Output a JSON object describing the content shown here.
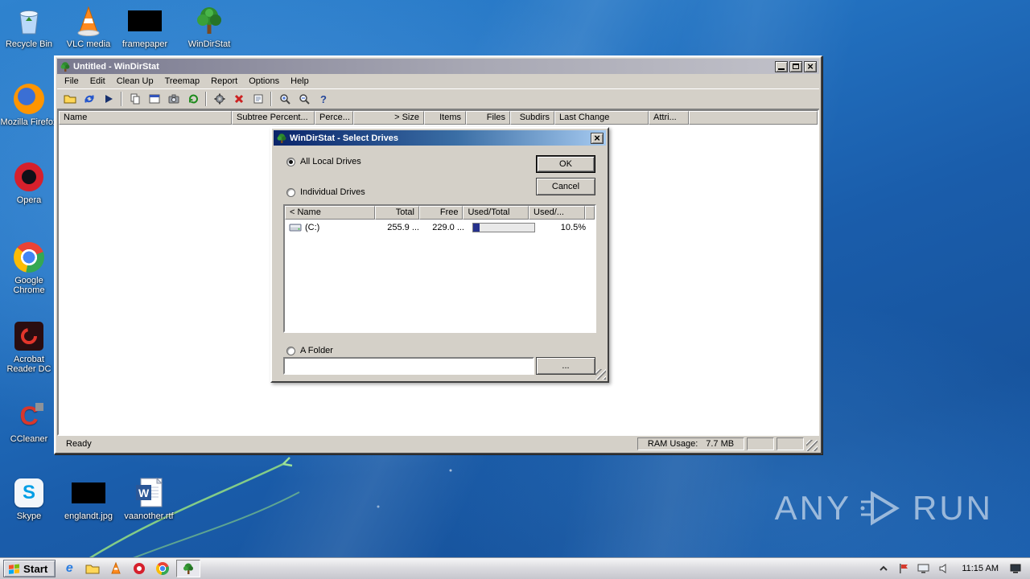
{
  "app": {
    "name": "WinDirStat"
  },
  "desktop": {
    "icons": {
      "recycle_bin": "Recycle Bin",
      "vlc": "VLC media",
      "framepaper": "framepaper",
      "windirstat": "WinDirStat",
      "firefox": "Mozilla Firefox",
      "opera": "Opera",
      "chrome": "Google Chrome",
      "acrobat": "Acrobat Reader DC",
      "ccleaner": "CCleaner",
      "skype": "Skype",
      "englandt": "englandt.jpg",
      "vaanother": "vaanother.rtf"
    },
    "watermark": {
      "left": "ANY",
      "right": "RUN"
    }
  },
  "main_window": {
    "title": "Untitled - WinDirStat",
    "menu": [
      "File",
      "Edit",
      "Clean Up",
      "Treemap",
      "Report",
      "Options",
      "Help"
    ],
    "toolbar_icons": [
      "open",
      "refresh-all",
      "resume",
      "copy",
      "open-explorer",
      "screenshot",
      "refresh-selected",
      "configure",
      "delete",
      "properties",
      "zoom-in",
      "zoom-out",
      "help"
    ],
    "columns": [
      "Name",
      "Subtree Percent...",
      "Perce...",
      "> Size",
      "Items",
      "Files",
      "Subdirs",
      "Last Change",
      "Attri..."
    ],
    "status": {
      "ready": "Ready",
      "ram_label": "RAM Usage:",
      "ram_value": "7.7 MB"
    }
  },
  "dialog": {
    "title": "WinDirStat - Select Drives",
    "options": {
      "all": "All Local Drives",
      "individual": "Individual Drives",
      "folder": "A Folder"
    },
    "selected_option": "All Local Drives",
    "buttons": {
      "ok": "OK",
      "cancel": "Cancel",
      "browse": "..."
    },
    "drive_list": {
      "columns": [
        "< Name",
        "Total",
        "Free",
        "Used/Total",
        "Used/..."
      ],
      "rows": [
        {
          "name": "(C:)",
          "total": "255.9 ...",
          "free": "229.0 ...",
          "used_pct": "10.5%",
          "used_fraction": 0.105
        }
      ]
    },
    "folder_path": ""
  },
  "taskbar": {
    "start": "Start",
    "quick_launch": [
      "internet-explorer",
      "explorer-folder",
      "vlc",
      "opera",
      "chrome"
    ],
    "active_task": "windirstat",
    "tray_icons": [
      "hidden-icons-chevron",
      "action-center-flag",
      "display",
      "volume",
      "network-status"
    ],
    "clock": "11:15 AM"
  },
  "colors": {
    "titlebar_active_start": "#0a246a",
    "titlebar_active_end": "#a6caf0",
    "window_face": "#d4d0c8",
    "progress_fill": "#26318c",
    "desktop_blue": "#1a5dab"
  }
}
